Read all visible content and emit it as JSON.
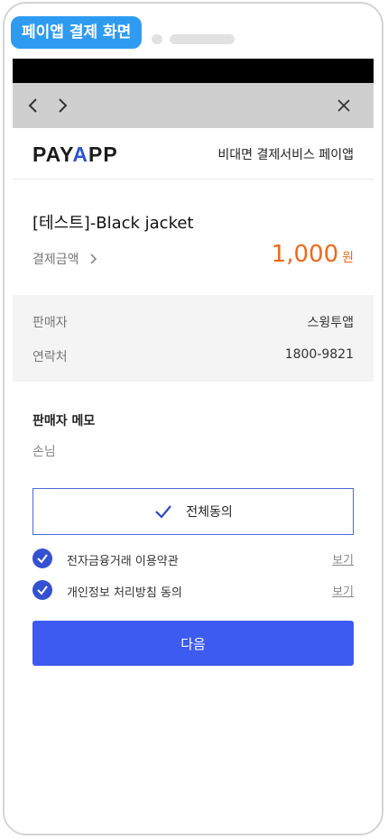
{
  "badge": {
    "label": "페이앱 결제 화면"
  },
  "browser": {
    "back_icon": "chevron-left-icon",
    "forward_icon": "chevron-right-icon",
    "close_icon": "close-icon"
  },
  "brand": {
    "logo_pre": "PAY",
    "logo_a": "A",
    "logo_post": "PP",
    "tagline": "비대면 결제서비스 페이앱"
  },
  "product": {
    "title": "[테스트]-Black jacket",
    "amount_label": "결제금액",
    "amount": "1,000",
    "currency": "원"
  },
  "seller": {
    "name_label": "판매자",
    "name": "스윙투앱",
    "contact_label": "연락처",
    "contact": "1800-9821"
  },
  "memo": {
    "title": "판매자 메모",
    "text": "손님"
  },
  "agreement": {
    "all_label": "전체동의",
    "terms": [
      {
        "label": "전자금융거래 이용약관",
        "view": "보기",
        "checked": true
      },
      {
        "label": "개인정보 처리방침 동의",
        "view": "보기",
        "checked": true
      }
    ]
  },
  "next_button": {
    "label": "다음"
  },
  "colors": {
    "badge": "#2f9bf0",
    "amount": "#ee6a1c",
    "primary": "#3d5af1",
    "check": "#3451d1"
  }
}
